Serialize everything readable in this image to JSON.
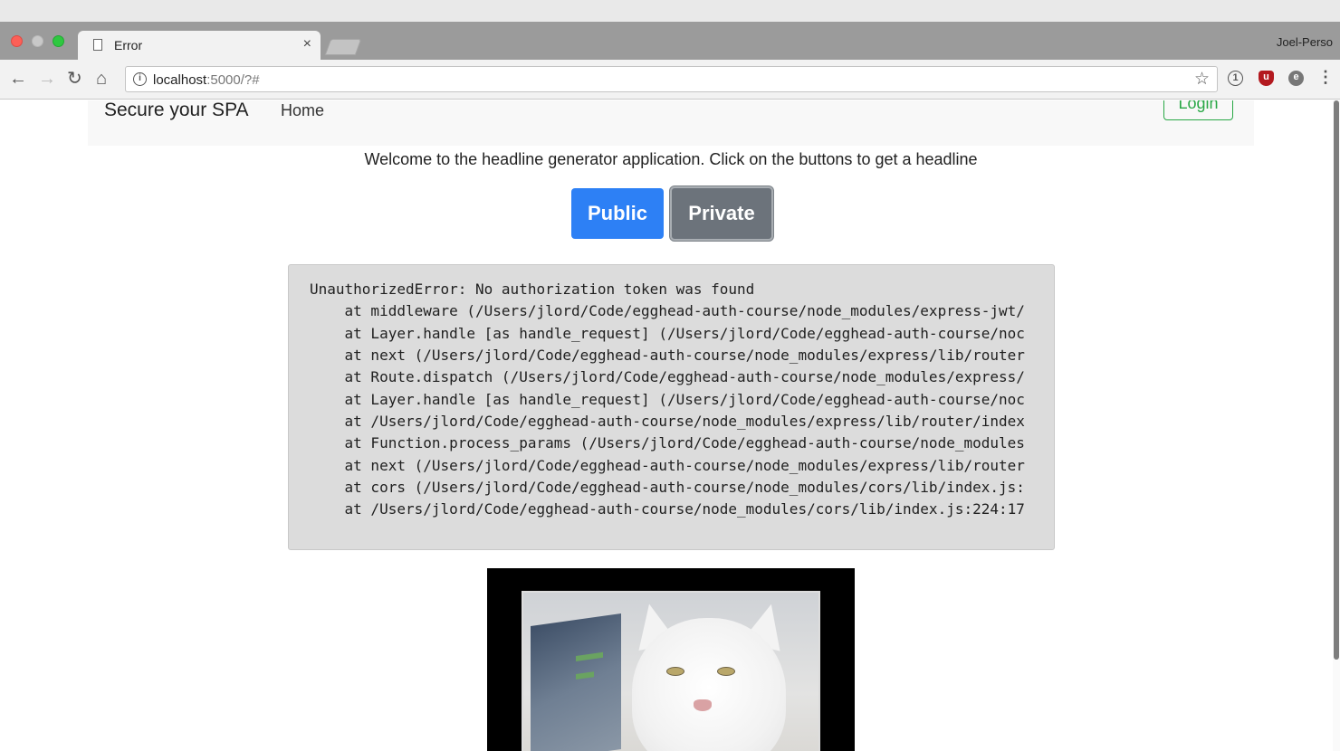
{
  "browser": {
    "tab_title": "Error",
    "tab_close": "×",
    "profile_name": "Joel-Perso",
    "url_host": "localhost",
    "url_rest": ":5000/?#"
  },
  "icons": {
    "back": "back-arrow-icon",
    "forward": "forward-arrow-icon",
    "reload": "reload-icon",
    "home": "home-icon",
    "info": "info-icon",
    "star": "bookmark-star-icon",
    "password": "password-manager-icon",
    "ublock": "ublock-icon",
    "evernote": "evernote-icon",
    "menu": "kebab-menu-icon"
  },
  "nav": {
    "brand": "Secure your SPA",
    "home": "Home",
    "login": "Login"
  },
  "main": {
    "welcome": "Welcome to the headline generator application. Click on the buttons to get a headline",
    "public_button": "Public",
    "private_button": "Private"
  },
  "error": {
    "lines": [
      "UnauthorizedError: No authorization token was found",
      "    at middleware (/Users/jlord/Code/egghead-auth-course/node_modules/express-jwt/",
      "    at Layer.handle [as handle_request] (/Users/jlord/Code/egghead-auth-course/noc",
      "    at next (/Users/jlord/Code/egghead-auth-course/node_modules/express/lib/router",
      "    at Route.dispatch (/Users/jlord/Code/egghead-auth-course/node_modules/express/",
      "    at Layer.handle [as handle_request] (/Users/jlord/Code/egghead-auth-course/noc",
      "    at /Users/jlord/Code/egghead-auth-course/node_modules/express/lib/router/index",
      "    at Function.process_params (/Users/jlord/Code/egghead-auth-course/node_modules",
      "    at next (/Users/jlord/Code/egghead-auth-course/node_modules/express/lib/router",
      "    at cors (/Users/jlord/Code/egghead-auth-course/node_modules/cors/lib/index.js:",
      "    at /Users/jlord/Code/egghead-auth-course/node_modules/cors/lib/index.js:224:17"
    ]
  },
  "colors": {
    "primary": "#2d80f5",
    "secondary": "#6c737b",
    "success": "#28a745"
  }
}
